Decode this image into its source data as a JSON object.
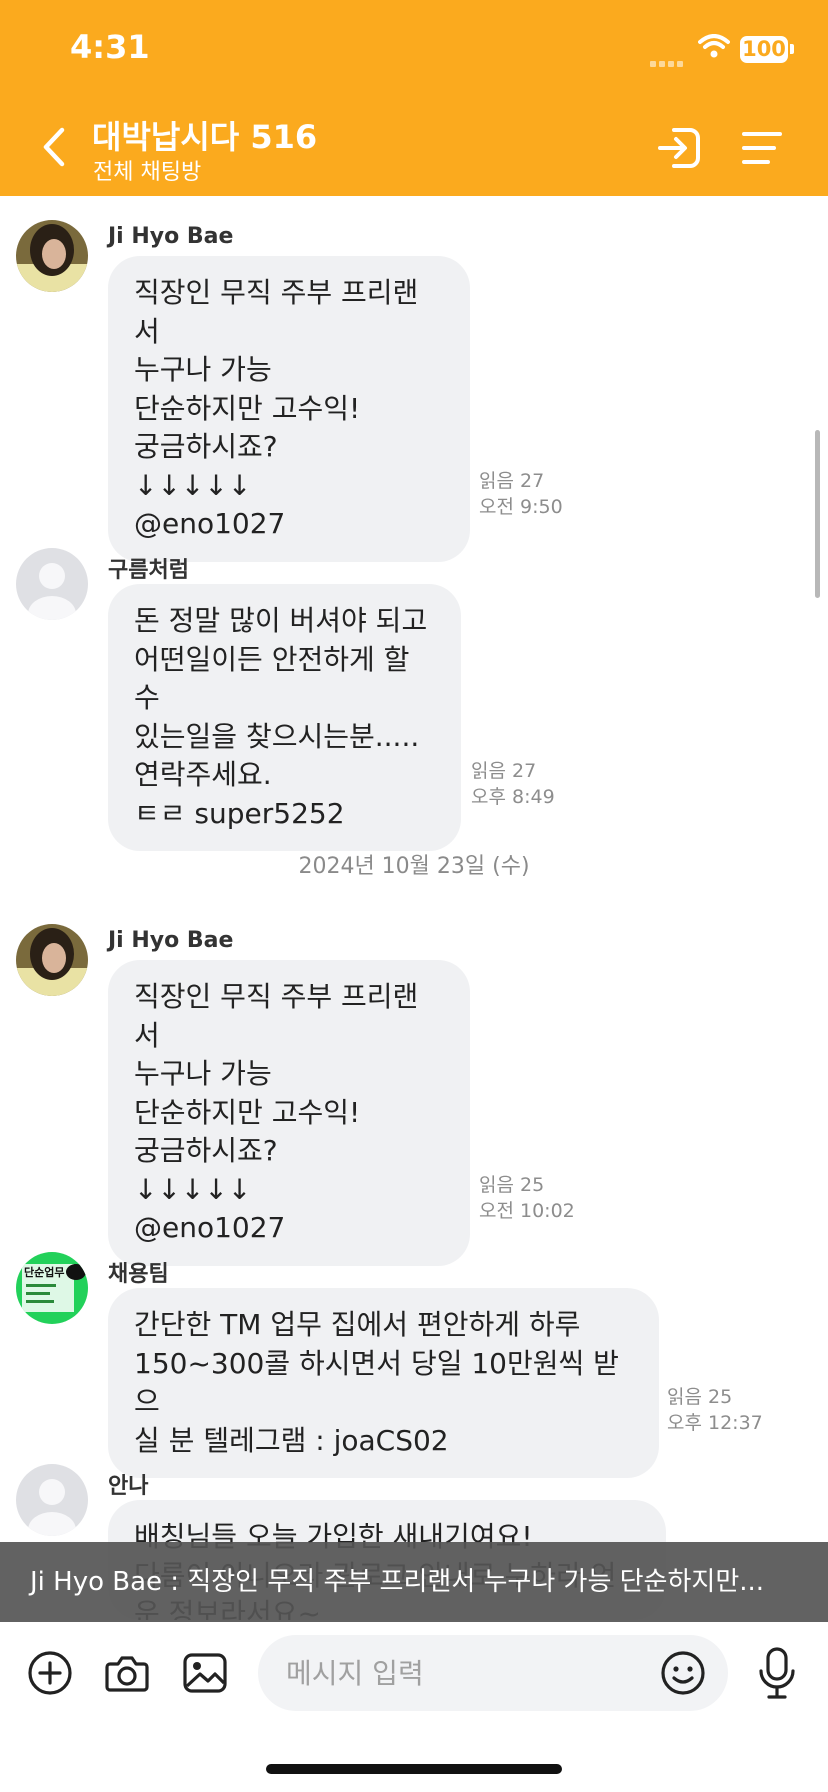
{
  "status_bar": {
    "time": "4:31",
    "battery": "100"
  },
  "header": {
    "title": "대박납시다 516",
    "subtitle": "전체 채팅방"
  },
  "messages": [
    {
      "sender": "Ji Hyo Bae",
      "text": "직장인 무직 주부 프리랜서\n누구나 가능\n단순하지만 고수익!\n궁금하시죠?\n↓↓↓↓↓\n@eno1027",
      "read": "읽음 27",
      "time": "오전 9:50"
    },
    {
      "sender": "구름처럼",
      "text": "돈 정말 많이 버셔야 되고\n어떤일이든 안전하게 할수\n있는일을 찾으시는분.....\n연락주세요.\nㅌㄹ super5252",
      "read": "읽음 27",
      "time": "오후 8:49"
    },
    {
      "sender": "Ji Hyo Bae",
      "text": "직장인 무직 주부 프리랜서\n누구나 가능\n단순하지만 고수익!\n궁금하시죠?\n↓↓↓↓↓\n@eno1027",
      "read": "읽음 25",
      "time": "오전 10:02"
    },
    {
      "sender": "채용팀",
      "text": "간단한 TM 업무 집에서 편안하게 하루\n150~300콜 하시면서 당일 10만원씩 받으\n실 분 텔레그램 : joaCS02",
      "read": "읽음 25",
      "time": "오후 12:37",
      "avatar_label": "단순업무"
    },
    {
      "sender": "안나",
      "text": "배칭님들 오늘 가입한 새내기여요!\n다름이 아니오라 관로그 안내로 누하라 언\n운 정보라서요~"
    }
  ],
  "date_separator": "2024년 10월 23일 (수)",
  "preview": {
    "sender": "Ji Hyo Bae",
    "separator": " : ",
    "text": "직장인 무직 주부 프리랜서 누구나 가능 단순하지만..."
  },
  "input": {
    "placeholder": "메시지 입력"
  },
  "colors": {
    "header": "#FBAA1E",
    "bubble": "#F0F1F3",
    "banner": "#555555"
  },
  "icons": [
    "back-icon",
    "exit-icon",
    "menu-icon",
    "add-icon",
    "camera-icon",
    "gallery-icon",
    "emoji-icon",
    "mic-icon"
  ]
}
